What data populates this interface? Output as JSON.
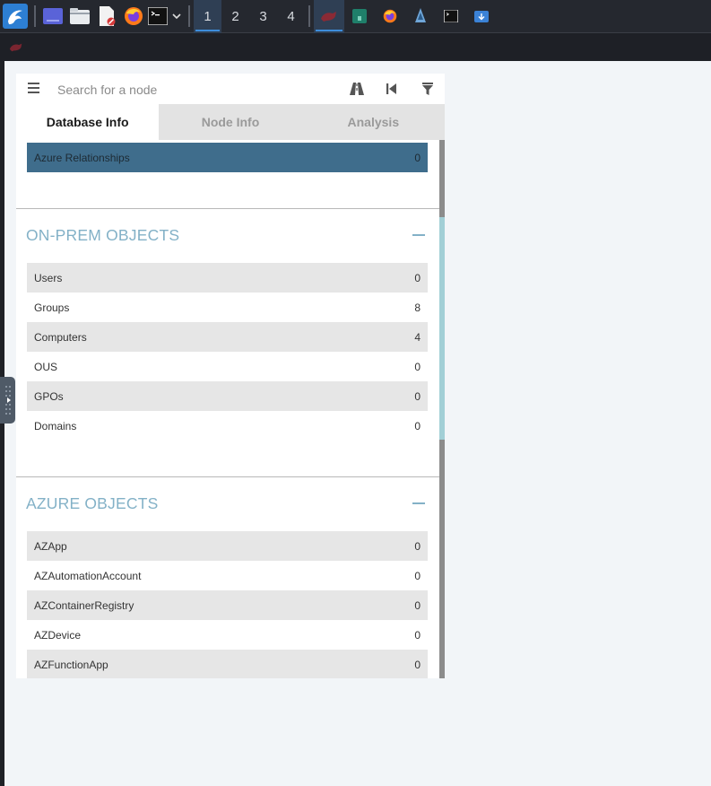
{
  "taskbar": {
    "workspaces": [
      "1",
      "2",
      "3",
      "4"
    ],
    "active_workspace": "1"
  },
  "search": {
    "placeholder": "Search for a node"
  },
  "tabs": [
    {
      "label": "Database Info",
      "active": true
    },
    {
      "label": "Node Info",
      "active": false
    },
    {
      "label": "Analysis",
      "active": false
    }
  ],
  "top_rows": [
    {
      "label": "Azure Relationships",
      "value": "0"
    }
  ],
  "onprem": {
    "title": "ON-PREM OBJECTS",
    "rows": [
      {
        "label": "Users",
        "value": "0"
      },
      {
        "label": "Groups",
        "value": "8"
      },
      {
        "label": "Computers",
        "value": "4"
      },
      {
        "label": "OUS",
        "value": "0"
      },
      {
        "label": "GPOs",
        "value": "0"
      },
      {
        "label": "Domains",
        "value": "0"
      }
    ]
  },
  "azure": {
    "title": "AZURE OBJECTS",
    "rows": [
      {
        "label": "AZApp",
        "value": "0"
      },
      {
        "label": "AZAutomationAccount",
        "value": "0"
      },
      {
        "label": "AZContainerRegistry",
        "value": "0"
      },
      {
        "label": "AZDevice",
        "value": "0"
      },
      {
        "label": "AZFunctionApp",
        "value": "0"
      }
    ]
  },
  "colors": {
    "selected_row": "#3f6d8c",
    "section_title": "#83b1c7",
    "scroll_thumb": "#a2cfd6",
    "taskbar": "#25282f"
  }
}
